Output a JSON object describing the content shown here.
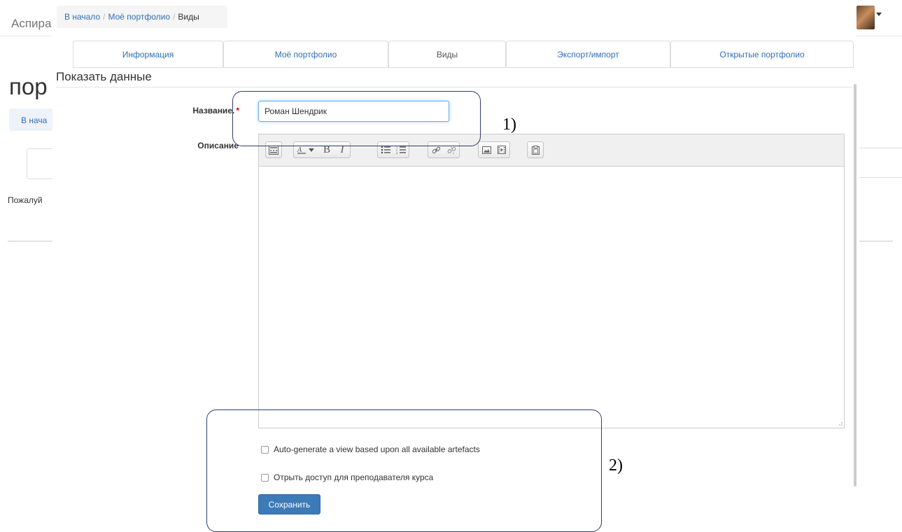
{
  "background": {
    "brand": "Аспира",
    "heading": "пор",
    "home_button": "В нача",
    "text": "Пожалуй"
  },
  "breadcrumb": {
    "items": [
      "В начало",
      "Моё портфолио",
      "Виды"
    ]
  },
  "tabs": [
    {
      "label": "Информация",
      "active": false
    },
    {
      "label": "Моё портфолио",
      "active": false
    },
    {
      "label": "Виды",
      "active": true
    },
    {
      "label": "Экспорт/импорт",
      "active": false
    },
    {
      "label": "Открытые портфолио",
      "active": false
    }
  ],
  "form": {
    "section_title": "Показать данные",
    "name_label": "Название.",
    "required_mark": "*",
    "name_value": "Роман Шендрик",
    "description_label": "Описание",
    "checkbox_autogen": "Auto-generate a view based upon all available artefacts",
    "checkbox_access": "Отрыть доступ для преподавателя курса",
    "save_label": "Сохранить"
  },
  "toolbar_icons": [
    "toggle-toolbar-icon",
    "font-color-icon",
    "bold-icon",
    "italic-icon",
    "unordered-list-icon",
    "ordered-list-icon",
    "link-icon",
    "unlink-icon",
    "image-icon",
    "media-icon",
    "paste-icon"
  ],
  "annotations": {
    "callout_1": "1)",
    "callout_2": "2)"
  },
  "colors": {
    "accent": "#3d7ab8",
    "link": "#2f6fb5",
    "callout_border": "#2d3e6e",
    "required": "#dd0000"
  }
}
